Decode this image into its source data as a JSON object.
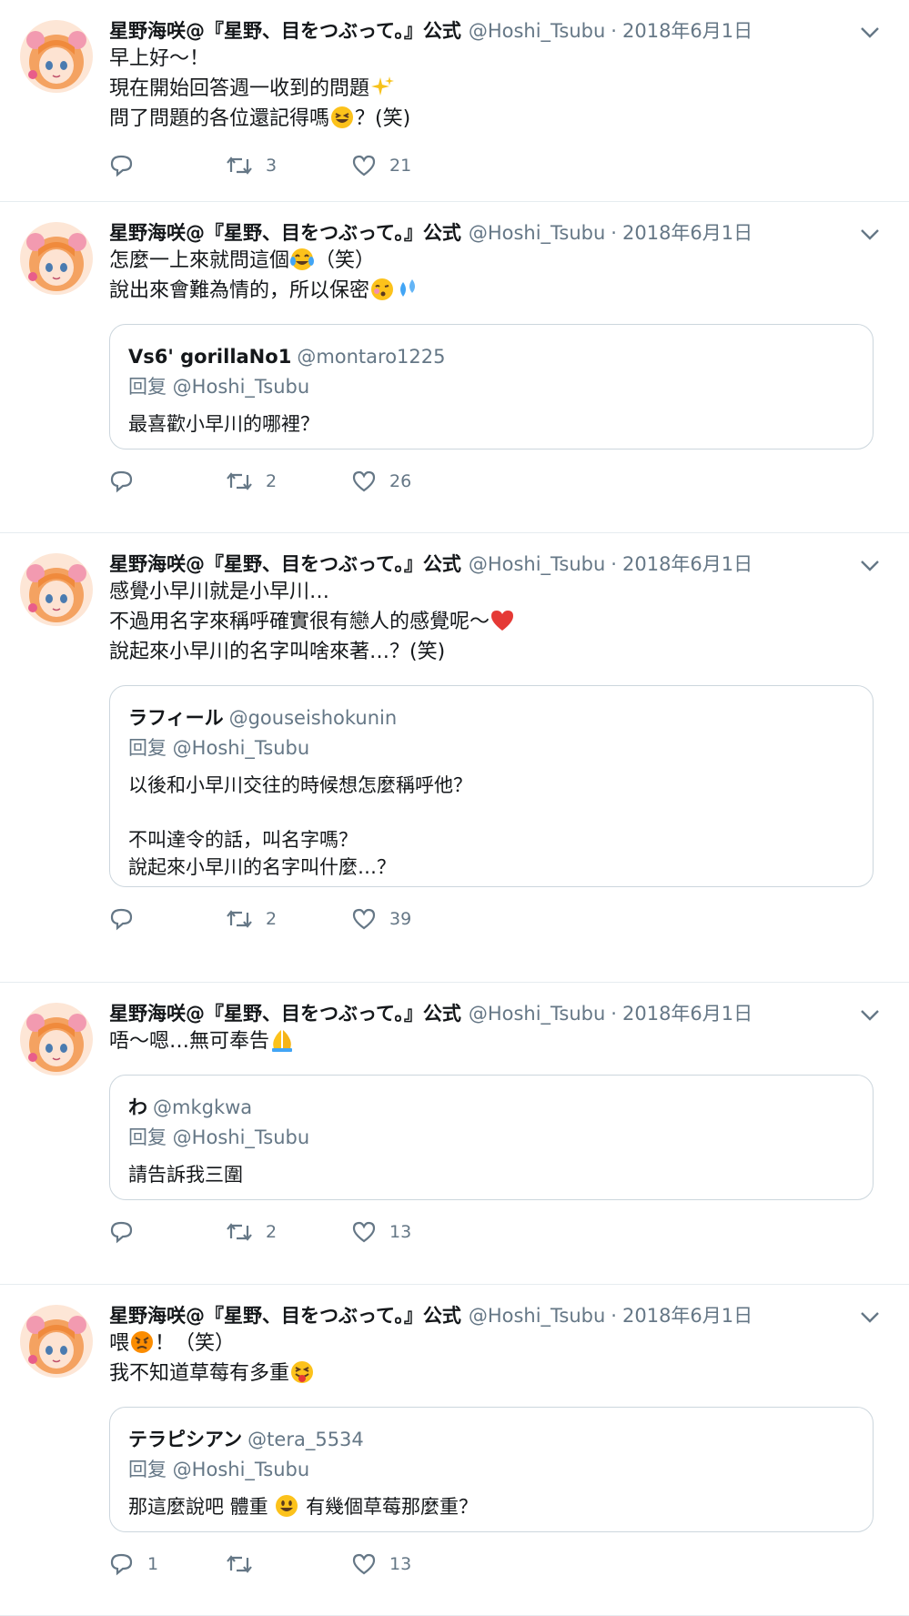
{
  "tweets": [
    {
      "author": {
        "name": "星野海咲@『星野、目をつぶって。』公式",
        "handle": "@Hoshi_Tsubu",
        "date": "2018年6月1日"
      },
      "lines": [
        "早上好～！",
        "現在開始回答週一收到的問題",
        "問了問題的各位還記得嗎",
        "？(笑)"
      ],
      "quote": null,
      "counts": {
        "reply": "",
        "retweet": "3",
        "like": "21"
      }
    },
    {
      "author": {
        "name": "星野海咲@『星野、目をつぶって。』公式",
        "handle": "@Hoshi_Tsubu",
        "date": "2018年6月1日"
      },
      "lines": [
        "怎麼一上來就問這個",
        "（笑）",
        "說出來會難為情的，所以保密"
      ],
      "quote": {
        "name": "Vs6' gorillaNo1",
        "handle": "@montaro1225",
        "reply_to": "回复 @Hoshi_Tsubu",
        "lines": [
          "最喜歡小早川的哪裡？"
        ]
      },
      "counts": {
        "reply": "",
        "retweet": "2",
        "like": "26"
      }
    },
    {
      "author": {
        "name": "星野海咲@『星野、目をつぶって。』公式",
        "handle": "@Hoshi_Tsubu",
        "date": "2018年6月1日"
      },
      "lines": [
        "感覺小早川就是小早川…",
        "不過用名字來稱呼確實很有戀人的感覺呢～",
        "說起來小早川的名字叫啥來著…？(笑)"
      ],
      "quote": {
        "name": "ラフィール",
        "handle": "@gouseishokunin",
        "reply_to": "回复 @Hoshi_Tsubu",
        "lines": [
          "以後和小早川交往的時候想怎麼稱呼他？",
          "",
          "不叫達令的話，叫名字嗎？",
          "說起來小早川的名字叫什麼…？"
        ]
      },
      "counts": {
        "reply": "",
        "retweet": "2",
        "like": "39"
      }
    },
    {
      "author": {
        "name": "星野海咲@『星野、目をつぶって。』公式",
        "handle": "@Hoshi_Tsubu",
        "date": "2018年6月1日"
      },
      "lines": [
        "唔～嗯…無可奉告"
      ],
      "quote": {
        "name": "わ",
        "handle": "@mkgkwa",
        "reply_to": "回复 @Hoshi_Tsubu",
        "lines": [
          "請告訴我三圍"
        ]
      },
      "counts": {
        "reply": "",
        "retweet": "2",
        "like": "13"
      }
    },
    {
      "author": {
        "name": "星野海咲@『星野、目をつぶって。』公式",
        "handle": "@Hoshi_Tsubu",
        "date": "2018年6月1日"
      },
      "lines": [
        "喂",
        "！（笑）",
        "我不知道草莓有多重"
      ],
      "quote": {
        "name": "テラピシアン",
        "handle": "@tera_5534",
        "reply_to": "回复 @Hoshi_Tsubu",
        "lines": [
          "那這麼說吧 體重",
          "有幾個草莓那麼重？"
        ]
      },
      "counts": {
        "reply": "1",
        "retweet": "",
        "like": "13"
      }
    }
  ],
  "icons": {
    "caret": "chevron-down-icon",
    "reply": "reply-icon",
    "retweet": "retweet-icon",
    "like": "like-icon",
    "sparkles": "sparkles-emoji",
    "grin": "grinning-squint-emoji",
    "tears": "tears-of-joy-emoji",
    "kiss": "kissing-emoji",
    "sweat": "sweat-droplets-emoji",
    "heart": "red-heart-emoji",
    "pray": "folded-hands-emoji",
    "angry": "angry-face-emoji",
    "tongue": "tongue-wink-emoji",
    "smiley": "smiley-emoji"
  },
  "colors": {
    "text": "#14171a",
    "secondary": "#657786",
    "border": "#e6ecf0",
    "quote_border": "#ccd6dd"
  }
}
